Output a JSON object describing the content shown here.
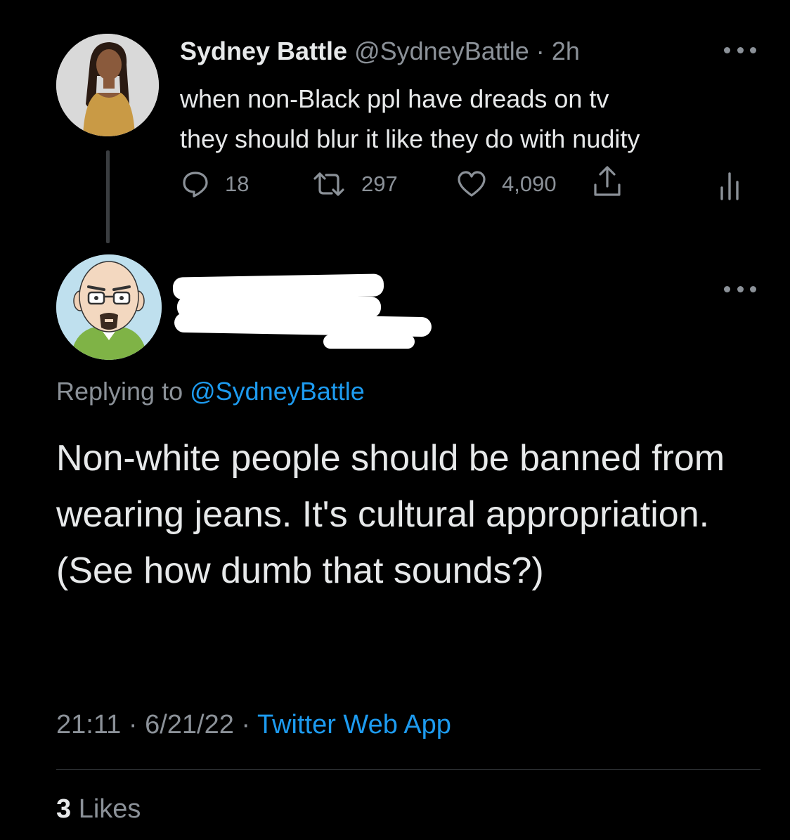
{
  "parent_tweet": {
    "display_name": "Sydney Battle",
    "handle": "@SydneyBattle",
    "separator": "·",
    "time_ago": "2h",
    "text_lines": [
      "when non-Black ppl have dreads on tv",
      "they should blur it like they do with nudity"
    ],
    "actions": {
      "replies": "18",
      "retweets": "297",
      "likes": "4,090"
    },
    "icons": [
      "reply-icon",
      "retweet-icon",
      "heart-icon",
      "share-icon",
      "analytics-icon",
      "more-icon"
    ]
  },
  "reply_tweet": {
    "replying_to_prefix": "Replying to",
    "replying_to_handle": "@SydneyBattle",
    "text": "Non-white people should be banned from wearing jeans. It's cultural appropriation. (See how dumb that sounds?)",
    "time": "21:11",
    "separator": "·",
    "date": "6/21/22",
    "source": "Twitter Web App",
    "likes_count": "3",
    "likes_label": "Likes"
  },
  "colors": {
    "background": "#000000",
    "primary_text": "#e7e9ea",
    "secondary_text": "#8b9198",
    "link": "#1d9bf0",
    "divider": "#2f3336",
    "redaction": "#ffffff"
  }
}
